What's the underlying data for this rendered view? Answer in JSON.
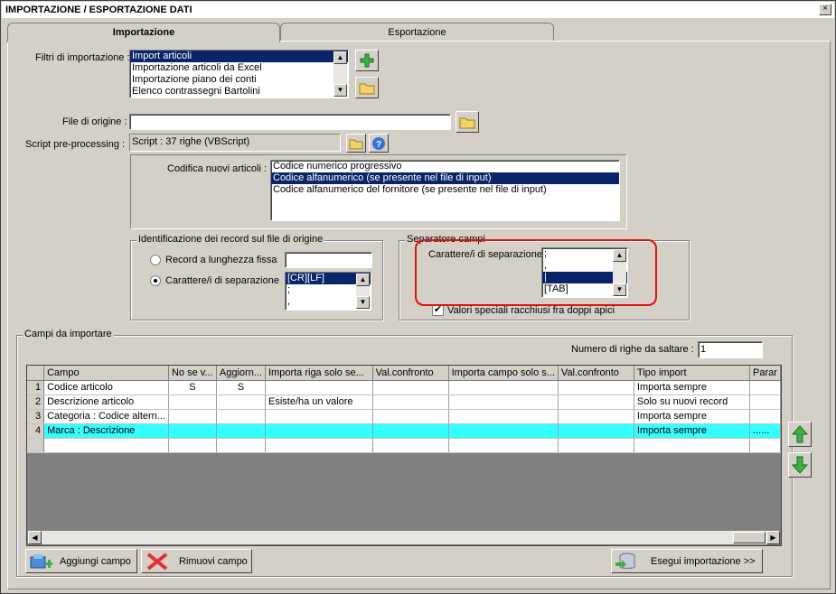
{
  "window": {
    "title": "IMPORTAZIONE / ESPORTAZIONE DATI",
    "close": "×"
  },
  "tabs": [
    {
      "label": "Importazione"
    },
    {
      "label": "Esportazione"
    }
  ],
  "filters": {
    "label": "Filtri di importazione :",
    "items": [
      "Import articoli",
      "Importazione articoli da Excel",
      "Importazione piano dei conti",
      "Elenco contrassegni Bartolini"
    ],
    "selected_index": 0
  },
  "source_file": {
    "label": "File di origine :",
    "value": ""
  },
  "script": {
    "label": "Script pre-processing :",
    "value": "Script : 37 righe (VBScript)"
  },
  "coding": {
    "label": "Codifica nuovi articoli :",
    "items": [
      "Codice numerico progressivo",
      "Codice alfanumerico (se presente nel file di input)",
      "Codice alfanumerico del fornitore (se presente nel file di input)"
    ],
    "selected_index": 1
  },
  "record_id": {
    "title": "Identificazione dei record sul file di origine",
    "fixed_label": "Record a lunghezza fissa",
    "fixed_value": "",
    "sep_label": "Carattere/i di separazione",
    "sep_items": [
      "[CR][LF]",
      ";",
      ","
    ]
  },
  "field_sep": {
    "title": "Separatore campi",
    "label": "Carattere/i di separazione",
    "items": [
      ";",
      ",",
      "|",
      "[TAB]"
    ],
    "selected_index": 2,
    "quoted_label": "Valori speciali racchiusi fra doppi apici",
    "quoted_checked": true
  },
  "fields": {
    "title": "Campi da importare",
    "skip_label": "Numero di righe da saltare  :",
    "skip_value": "1",
    "columns": [
      "Campo",
      "No se v...",
      "Aggiorn...",
      "Importa riga solo se...",
      "Val.confronto",
      "Importa campo solo s...",
      "Val.confronto",
      "Tipo import",
      "Parar"
    ],
    "rows": [
      {
        "n": "1",
        "cells": [
          "Codice articolo",
          "S",
          "S",
          "",
          "",
          "",
          "",
          "Importa sempre",
          ""
        ]
      },
      {
        "n": "2",
        "cells": [
          "Descrizione articolo",
          "",
          "",
          "Esiste/ha un valore",
          "",
          "",
          "",
          "Solo su nuovi record",
          ""
        ]
      },
      {
        "n": "3",
        "cells": [
          "Categoria : Codice altern...",
          "",
          "",
          "",
          "",
          "",
          "",
          "Importa sempre",
          ""
        ]
      },
      {
        "n": "4",
        "cells": [
          "Marca : Descrizione",
          "",
          "",
          "",
          "",
          "",
          "",
          "Importa sempre",
          "......"
        ]
      }
    ],
    "highlight_row": 3
  },
  "buttons": {
    "add_field": "Aggiungi campo",
    "remove_field": "Rimuovi campo",
    "run_import": "Esegui importazione >>"
  },
  "colors": {
    "selection": "#0a246a",
    "highlight_row": "#33ffff",
    "annotation": "#e01010"
  }
}
